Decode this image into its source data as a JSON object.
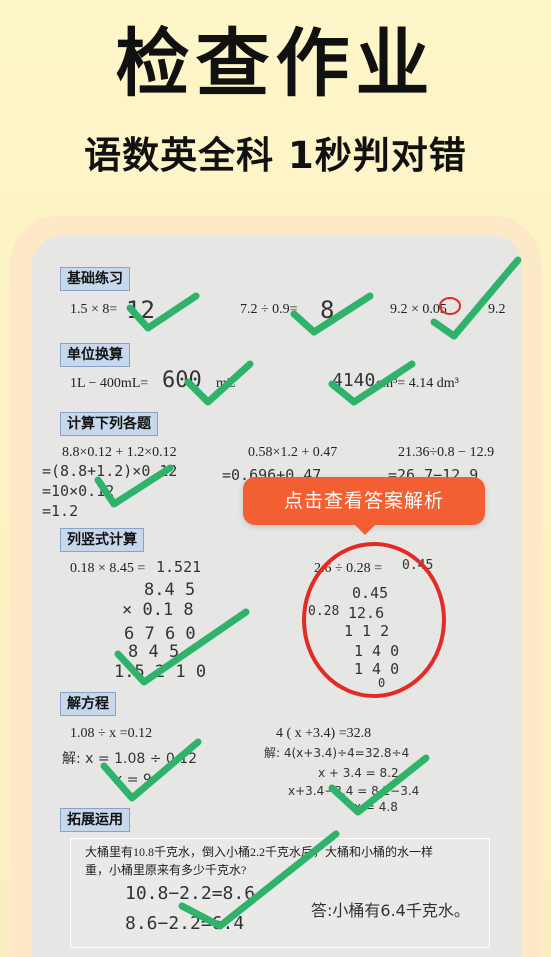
{
  "hero": {
    "title": "检查作业",
    "subtitle": "语数英全科 1秒判对错"
  },
  "sections": {
    "s1": "基础练习",
    "s2": "单位换算",
    "s3": "计算下列各题",
    "s4": "列竖式计算",
    "s5": "解方程",
    "s6": "拓展运用"
  },
  "problems": {
    "p1": "1.5 × 8=",
    "p1a": "12",
    "p2": "7.2 ÷ 0.9=",
    "p2a": "8",
    "p3": "9.2 × 0.05",
    "p3b": "9.2",
    "u1": "1L − 400mL=",
    "u1a": "600",
    "u1u": "mL",
    "u2a": "4140",
    "u2": "cm³= 4.14 dm³",
    "c1": "8.8×0.12 + 1.2×0.12",
    "c2": "0.58×1.2 + 0.47",
    "c3": "21.36÷0.8 − 12.9",
    "c1w1": "=(8.8+1.2)×0.12",
    "c1w2": "=10×0.12",
    "c1w3": "=1.2",
    "c2w1": "=0.696+0.47",
    "c3w1": "=26.7−12.9",
    "v1": "0.18 × 8.45 =",
    "v1a": "1.521",
    "v1r1": "8.4 5",
    "v1r2": "× 0.1 8",
    "v1r3": "6 7 6 0",
    "v1r4": "8 4 5",
    "v1r5": "1.5 2 1 0",
    "v2": "2.6 ÷ 0.28 =",
    "v2a": "0.45",
    "v2q": "0.45",
    "v2d": "0.28",
    "v2n": "12.6",
    "v2r1": "1 1 2",
    "v2r2": "1 4 0",
    "v2r3": "1 4 0",
    "v2r4": "0",
    "e1": "1.08 ÷ x =0.12",
    "e1w1": "解: x = 1.08 ÷ 0.12",
    "e1w2": "x = 9",
    "e2": "4 ( x +3.4) =32.8",
    "e2w1": "解: 4(x+3.4)÷4=32.8÷4",
    "e2w2": "x + 3.4 = 8.2",
    "e2w3": "x+3.4−3.4 = 8.2−3.4",
    "e2w4": "x = 4.8",
    "w1": "大桶里有10.8千克水，倒入小桶2.2千克水后，大桶和小桶的水一样",
    "w2": "重，小桶里原来有多少千克水?",
    "ww1": "10.8−2.2=8.6",
    "ww2": "8.6−2.2=6.4",
    "wans": "答:小桶有6.4千克水。"
  },
  "tooltip": {
    "label": "点击查看答案解析"
  },
  "colors": {
    "check": "#2fb36b",
    "circle": "#e32b26",
    "tooltip": "#f15f32",
    "tag": "#c7d8ec"
  }
}
